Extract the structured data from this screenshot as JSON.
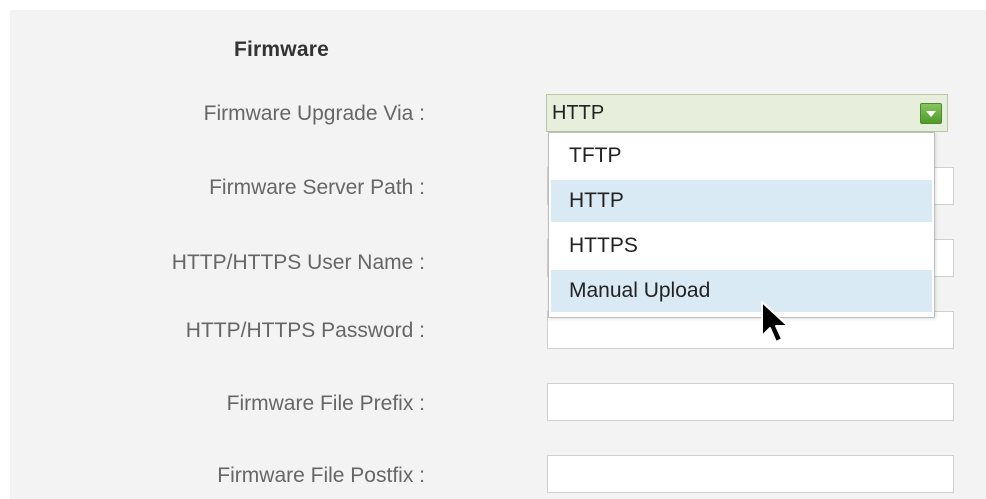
{
  "section": {
    "title": "Firmware"
  },
  "fields": {
    "upgrade_via": {
      "label": "Firmware Upgrade Via :",
      "value": "HTTP"
    },
    "server_path": {
      "label": "Firmware Server Path :",
      "value": ""
    },
    "user_name": {
      "label": "HTTP/HTTPS User Name :",
      "value": ""
    },
    "password": {
      "label": "HTTP/HTTPS Password :",
      "value": ""
    },
    "file_prefix": {
      "label": "Firmware File Prefix :",
      "value": ""
    },
    "file_postfix": {
      "label": "Firmware File Postfix :",
      "value": ""
    }
  },
  "dropdown": {
    "options": [
      {
        "label": "TFTP",
        "highlighted": false
      },
      {
        "label": "HTTP",
        "highlighted": true
      },
      {
        "label": "HTTPS",
        "highlighted": false
      },
      {
        "label": "Manual Upload",
        "highlighted": true
      }
    ]
  },
  "colors": {
    "panel_bg": "#f3f3f3",
    "select_bg": "#e7efdc",
    "option_highlight": "#daeaf5",
    "arrow_green": "#5aa934"
  },
  "icons": {
    "select_arrow": "chevron-down-icon",
    "cursor": "mouse-pointer-icon"
  }
}
